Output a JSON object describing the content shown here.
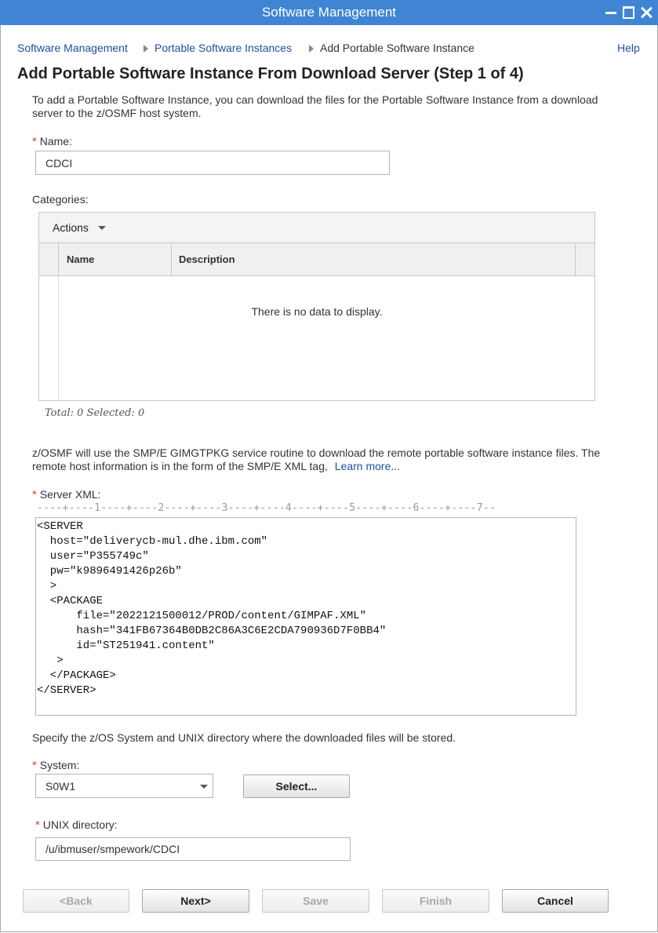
{
  "window": {
    "title": "Software Management"
  },
  "breadcrumb": {
    "items": [
      "Software Management",
      "Portable Software Instances",
      "Add Portable Software Instance"
    ],
    "help": "Help"
  },
  "page": {
    "title": "Add Portable Software Instance From Download Server (Step 1 of 4)"
  },
  "intro": {
    "line1": "To add a Portable Software Instance, you can download the files for the Portable Software Instance from a download",
    "line2": "server to the z/OSMF host system."
  },
  "name_field": {
    "required_mark": "*",
    "label": "Name:",
    "value": "CDCI"
  },
  "categories": {
    "label": "Categories:",
    "actions_label": "Actions",
    "columns": [
      "Name",
      "Description"
    ],
    "empty_message": "There is no data to display.",
    "footer": "Total: 0 Selected: 0"
  },
  "smpe_info": {
    "line1": "z/OSMF will use the SMP/E GIMGTPKG service routine to download the remote portable software instance files. The",
    "line2": "remote host information is in the form of the SMP/E XML tag,",
    "learn_more": "Learn more..."
  },
  "server_xml": {
    "required_mark": "*",
    "label": "Server XML:",
    "ruler": "----+----1----+----2----+----3----+----4----+----5----+----6----+----7--",
    "lines": [
      "<SERVER",
      "  host=\"deliverycb-mul.dhe.ibm.com\"",
      "  user=\"P355749c\"",
      "  pw=\"k9896491426p26b\"",
      "  >",
      "  <PACKAGE",
      "      file=\"2022121500012/PROD/content/GIMPAF.XML\"",
      "      hash=\"341FB67364B0DB2C86A3C6E2CDA790936D7F0BB4\"",
      "      id=\"ST251941.content\"",
      "   >",
      "  </PACKAGE>",
      "</SERVER>"
    ]
  },
  "storage_info": "Specify the z/OS System and UNIX directory where the downloaded files will be stored.",
  "system_field": {
    "required_mark": "*",
    "label": "System:",
    "value": "S0W1",
    "select_button": "Select..."
  },
  "unix_field": {
    "required_mark": "*",
    "label": "UNIX directory:",
    "value": "/u/ibmuser/smpework/CDCI"
  },
  "buttons": {
    "back": "<Back",
    "next": "Next>",
    "save": "Save",
    "finish": "Finish",
    "cancel": "Cancel"
  },
  "colors": {
    "titlebar": "#3f85d3",
    "link": "#1d4fa3",
    "required": "#c2522b"
  }
}
